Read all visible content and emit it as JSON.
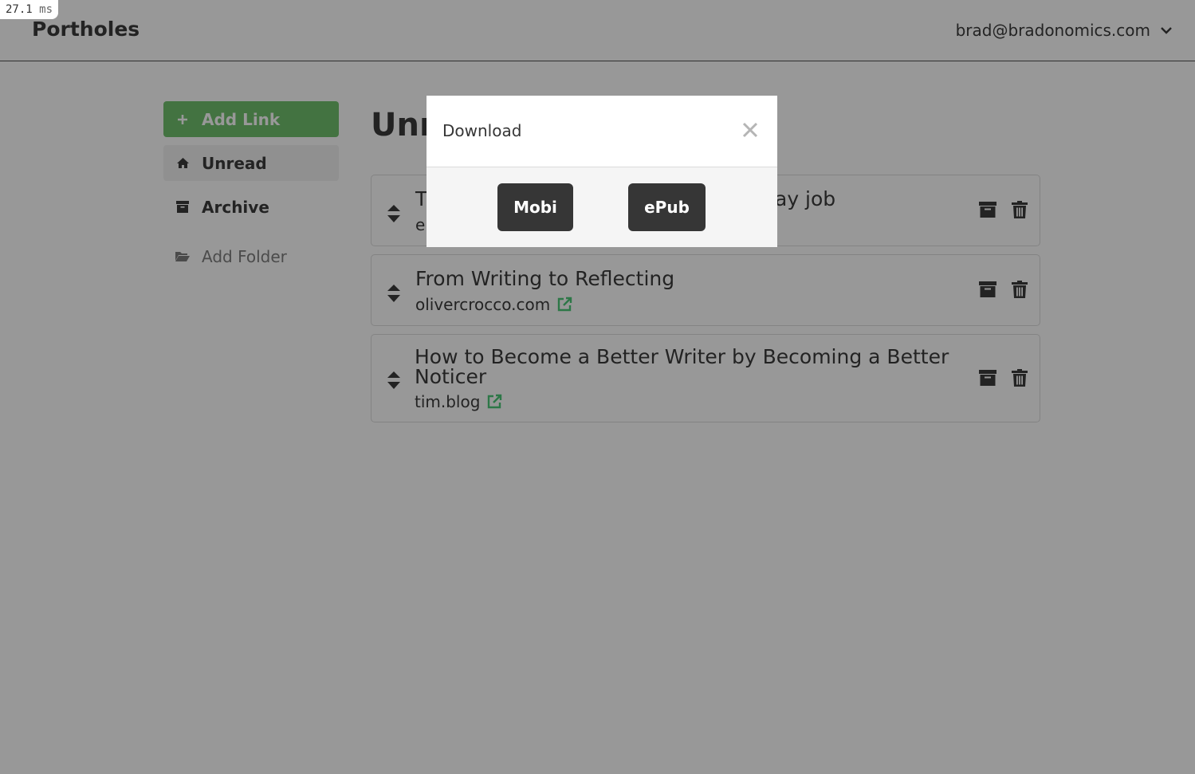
{
  "perf": {
    "value": "27.1",
    "unit": "ms"
  },
  "navbar": {
    "brand": "Portholes",
    "user_email": "brad@bradonomics.com"
  },
  "sidebar": {
    "add_link": "Add Link",
    "items": [
      {
        "label": "Unread",
        "icon": "home-icon"
      },
      {
        "label": "Archive",
        "icon": "archive-icon"
      }
    ],
    "add_folder": "Add Folder"
  },
  "main": {
    "title": "Unread",
    "links": [
      {
        "title": "T",
        "title_tail": "ay job",
        "domain": "e"
      },
      {
        "title": "From Writing to Reflecting",
        "domain": "olivercrocco.com"
      },
      {
        "title": "How to Become a Better Writer by Becoming a Better Noticer",
        "domain": "tim.blog"
      }
    ]
  },
  "modal": {
    "title": "Download",
    "buttons": {
      "mobi": "Mobi",
      "epub": "ePub"
    }
  },
  "colors": {
    "accent_green": "#48c774",
    "dark_button": "#363636",
    "text": "#363636"
  }
}
